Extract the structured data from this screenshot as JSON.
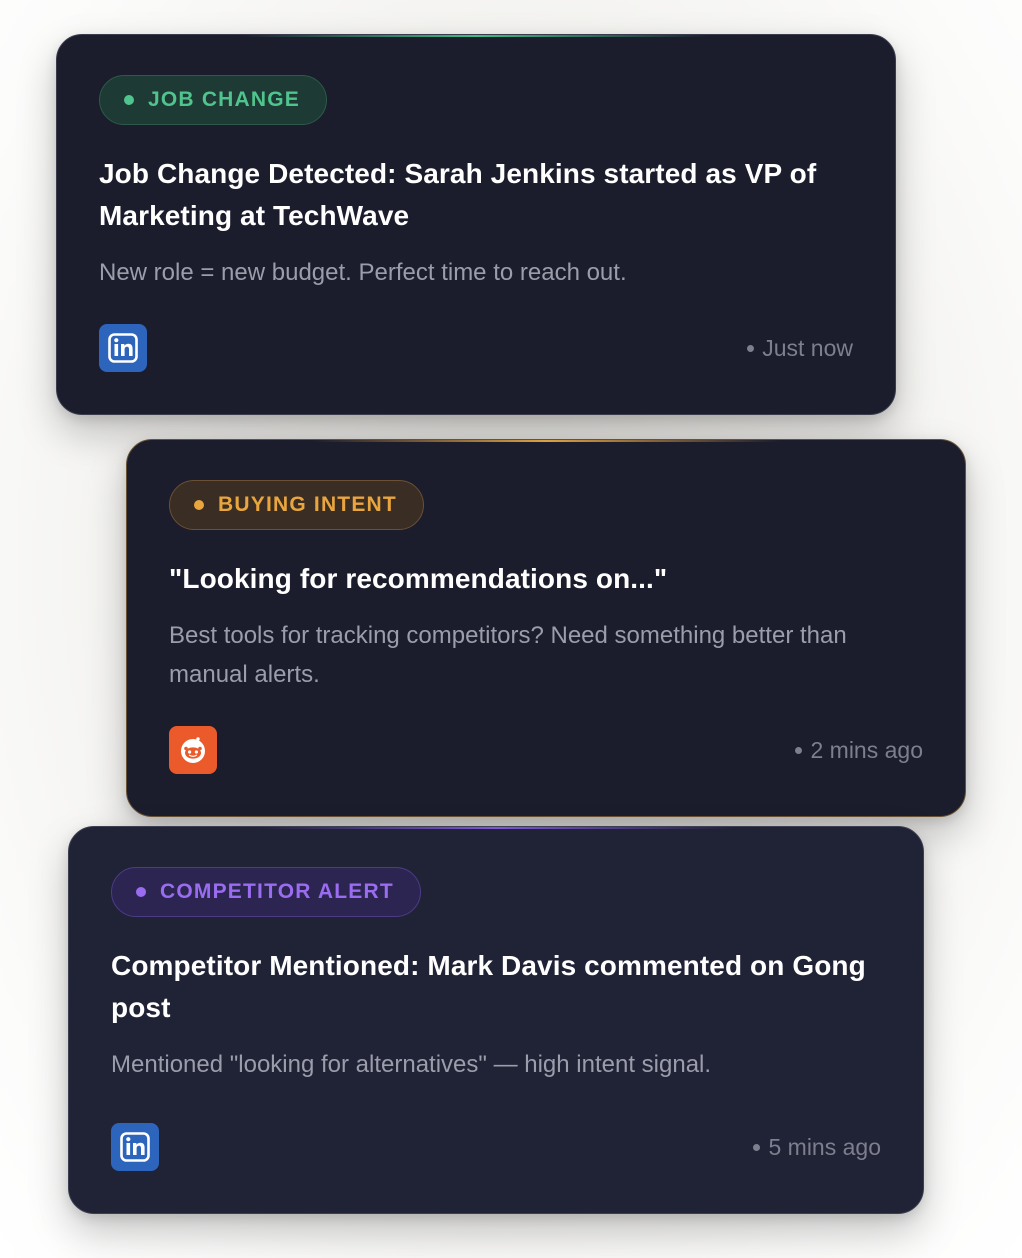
{
  "cards": [
    {
      "badge": "JOB CHANGE",
      "title": "Job Change Detected: Sarah Jenkins started as VP of Marketing at TechWave",
      "description": "New role = new budget. Perfect time to reach out.",
      "source_icon": "linkedin-icon",
      "time": "Just now",
      "accent": "#4fc48d"
    },
    {
      "badge": "BUYING INTENT",
      "title": "\"Looking for recommendations on...\"",
      "description": "Best tools for tracking competitors? Need something better than manual alerts.",
      "source_icon": "reddit-icon",
      "time": "2 mins ago",
      "accent": "#e9a53e"
    },
    {
      "badge": "COMPETITOR ALERT",
      "title": "Competitor Mentioned: Mark Davis commented on Gong post",
      "description": "Mentioned \"looking for alternatives\" — high intent signal.",
      "source_icon": "linkedin-icon",
      "time": "5 mins ago",
      "accent": "#9a6cf0"
    }
  ],
  "colors": {
    "card_bg": "#1b1c2c",
    "linkedin": "#2d64bc",
    "reddit": "#ea5a2a"
  }
}
